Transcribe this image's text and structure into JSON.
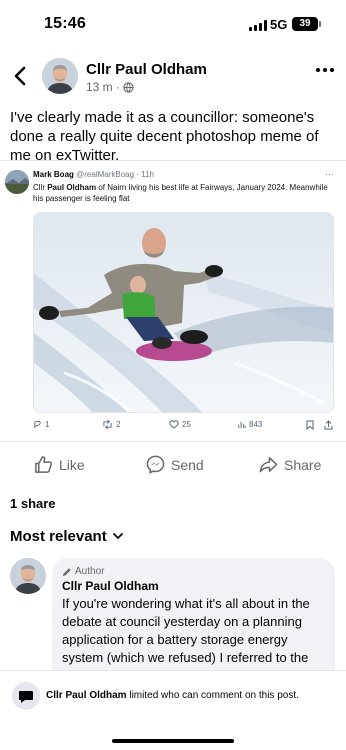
{
  "status_bar": {
    "time": "15:46",
    "network": "5G",
    "battery": "39"
  },
  "post": {
    "author": "Cllr Paul Oldham",
    "time": "13 m",
    "privacy_icon": "globe-icon",
    "text": "I've clearly made it as a councillor: someone's done a really quite decent photoshop meme of me on exTwitter."
  },
  "tweet": {
    "name": "Mark Boag",
    "handle": "@realMarkBoag",
    "time": "11h",
    "text_prefix": "Cllr ",
    "text_bold": "Paul Oldham",
    "text_rest": " of Nairn living his best life at Fairways, January 2024. Meanwhile his passenger is feeling flat",
    "replies": "1",
    "retweets": "2",
    "likes": "25",
    "views": "843"
  },
  "actions": {
    "like": "Like",
    "send": "Send",
    "share": "Share"
  },
  "shares_count": "1 share",
  "sort_label": "Most relevant",
  "comment": {
    "badge": "Author",
    "author": "Cllr Paul Oldham",
    "text": "If you're wondering what it's all about in the debate at council yesterday on a planning application for a battery storage energy system (which we refused) I referred to the fact that children sledged on the site as did"
  },
  "restriction": {
    "name": "Cllr Paul Oldham",
    "message": " limited who can comment on this post."
  },
  "colors": {
    "text": "#050505",
    "secondary": "#65676b",
    "bubble": "#f0f2f5"
  }
}
